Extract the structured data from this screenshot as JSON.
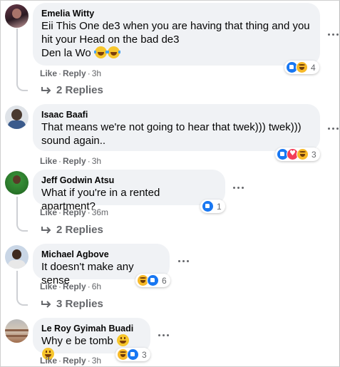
{
  "comments": [
    {
      "name": "Emelia Witty",
      "lines": [
        "Eii This One de3 when you are having that thing and you",
        "hit your Head on the bad de3",
        "Den la Wo"
      ],
      "like": "Like",
      "reply": "Reply",
      "time": "3h",
      "reaction_count": "4",
      "reactions": [
        "like",
        "haha"
      ],
      "replies": "2 Replies"
    },
    {
      "name": "Isaac Baafi",
      "lines": [
        "That means we're not going to hear that twek))) twek)))",
        "sound again.."
      ],
      "like": "Like",
      "reply": "Reply",
      "time": "3h",
      "reaction_count": "3",
      "reactions": [
        "like",
        "love",
        "haha"
      ]
    },
    {
      "name": "Jeff Godwin Atsu",
      "lines": [
        "What if you're in a rented apartment?"
      ],
      "like": "Like",
      "reply": "Reply",
      "time": "36m",
      "reaction_count": "1",
      "reactions": [
        "like"
      ],
      "replies": "2 Replies"
    },
    {
      "name": "Michael Agbove",
      "lines": [
        "It doesn't make any sense"
      ],
      "like": "Like",
      "reply": "Reply",
      "time": "6h",
      "reaction_count": "6",
      "reactions": [
        "haha",
        "like"
      ],
      "replies": "3 Replies"
    },
    {
      "name": "Le Roy Gyimah Buadi",
      "lines": [
        "Why e be tomb"
      ],
      "like": "Like",
      "reply": "Reply",
      "time": "3h",
      "reaction_count": "3",
      "reactions": [
        "haha",
        "like"
      ]
    }
  ],
  "colors": {
    "bubble": "#f0f2f5",
    "meta": "#65676b",
    "like_blue": "#1877f2",
    "love_red": "#f33e58",
    "haha_yellow": "#f7b928"
  },
  "icons": [
    "more-horizontal-icon",
    "reply-arrow-icon",
    "like-reaction-icon",
    "love-reaction-icon",
    "haha-reaction-icon",
    "tears-of-joy-emoji",
    "grinning-emoji"
  ]
}
